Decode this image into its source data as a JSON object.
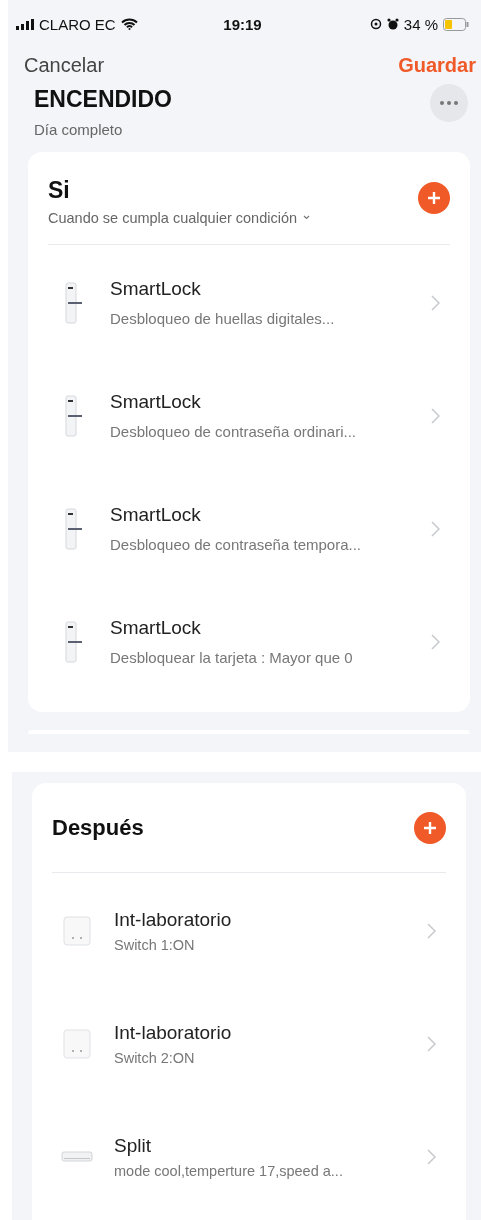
{
  "status_bar": {
    "carrier": "CLARO EC",
    "time": "19:19",
    "battery": "34 %"
  },
  "nav": {
    "cancel": "Cancelar",
    "save": "Guardar"
  },
  "scene": {
    "title": "ENCENDIDO",
    "subtitle": "Día completo"
  },
  "conditions": {
    "title": "Si",
    "subtitle": "Cuando se cumpla cualquier condición",
    "items": [
      {
        "kind": "lock",
        "name": "SmartLock",
        "detail": "Desbloqueo de huellas digitales..."
      },
      {
        "kind": "lock",
        "name": "SmartLock",
        "detail": "Desbloqueo de contraseña ordinari..."
      },
      {
        "kind": "lock",
        "name": "SmartLock",
        "detail": "Desbloqueo de contraseña tempora..."
      },
      {
        "kind": "lock",
        "name": "SmartLock",
        "detail": "Desbloquear la tarjeta : Mayor que 0"
      }
    ]
  },
  "actions": {
    "title": "Después",
    "items": [
      {
        "kind": "switch",
        "name": "Int-laboratorio",
        "detail": "Switch 1:ON"
      },
      {
        "kind": "switch",
        "name": "Int-laboratorio",
        "detail": "Switch 2:ON"
      },
      {
        "kind": "ac",
        "name": "Split",
        "detail": "mode cool,temperture 17,speed a..."
      }
    ]
  }
}
